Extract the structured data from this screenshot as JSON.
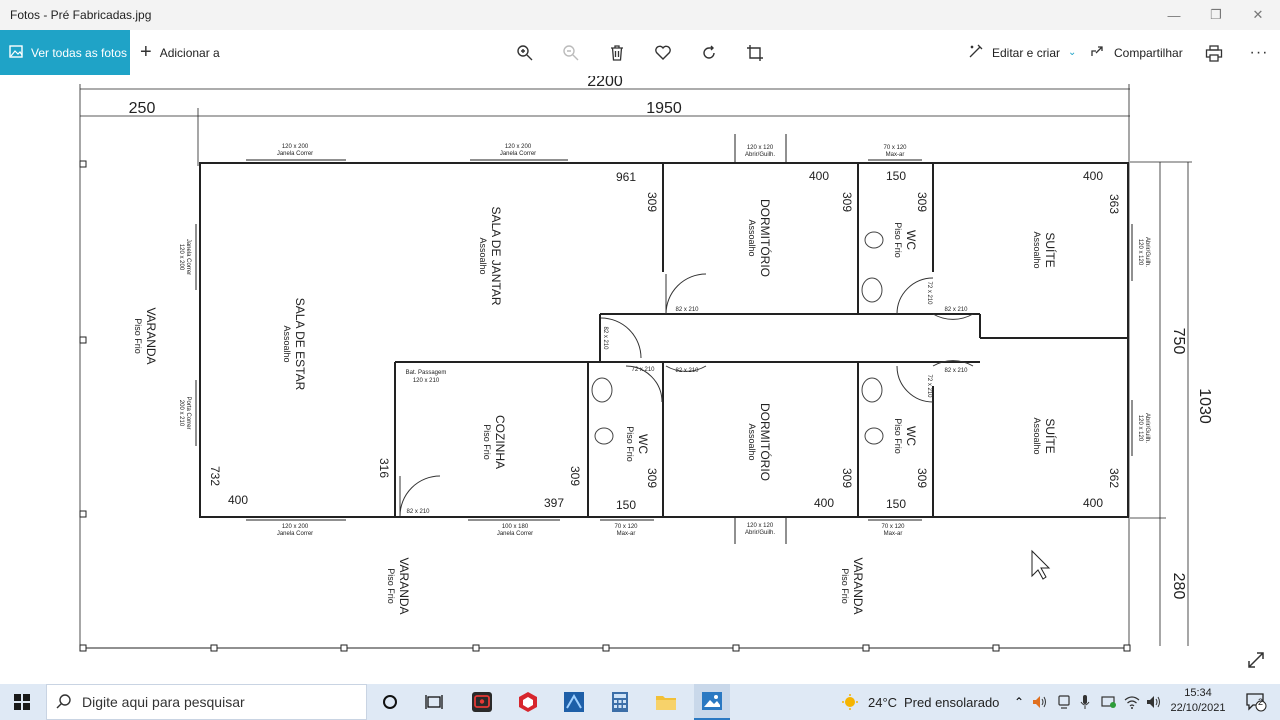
{
  "window": {
    "title": "Fotos - Pré Fabricadas.jpg",
    "controls": [
      "minimize-icon",
      "maximize-icon",
      "close-icon"
    ]
  },
  "toolbar": {
    "all_photos_label": "Ver todas as fotos",
    "add_label": "Adicionar a",
    "edit_create_label": "Editar e criar",
    "share_label": "Compartilhar",
    "icons": [
      "zoom-in-icon",
      "zoom-out-icon",
      "delete-icon",
      "favorite-icon",
      "rotate-icon",
      "crop-icon",
      "print-icon",
      "more-icon"
    ]
  },
  "plan": {
    "total_width": "2200",
    "left_width": "250",
    "main_width": "1950",
    "right_top": "750",
    "right_total": "1030",
    "right_bottom": "280",
    "rooms": {
      "sala_jantar": "SALA DE JANTAR",
      "sala_estar": "SALA DE ESTAR",
      "assoalho": "Assoalho",
      "varanda": "VARANDA",
      "piso_frio": "Piso Frio",
      "dormitorio": "DORMITÓRIO",
      "wc": "WC",
      "suite": "SUÍTE",
      "cozinha": "COZINHA"
    },
    "dims": {
      "d961": "961",
      "d309": "309",
      "d400": "400",
      "d150": "150",
      "d363": "363",
      "d732": "732",
      "d316": "316",
      "d397": "397",
      "d362": "362"
    },
    "openings": {
      "w120x200": "120 x 200",
      "janela_correr": "Janela Correr",
      "w120x120": "120 x 120",
      "abrir_guilh": "Abrir/Guilh.",
      "w70x120": "70 x 120",
      "max_ar": "Max-ar",
      "d82x210": "82 x 210",
      "d72x210": "72 x 210",
      "bat_passagem": "Bat. Passagem",
      "w120x210": "120 x 210",
      "w100x180": "100 x 180",
      "w200x210": "200 x 210",
      "porta_correr": "Porta Correr"
    }
  },
  "taskbar": {
    "search_placeholder": "Digite aqui para pesquisar",
    "weather_temp": "24°C",
    "weather_desc": "Pred ensolarado",
    "time": "15:34",
    "date": "22/10/2021",
    "notification_count": "2",
    "apps": [
      "cortana-icon",
      "task-view-icon",
      "screen-recorder-icon",
      "sketchup-icon",
      "app-icon",
      "calculator-icon",
      "file-explorer-icon",
      "photos-icon"
    ]
  }
}
